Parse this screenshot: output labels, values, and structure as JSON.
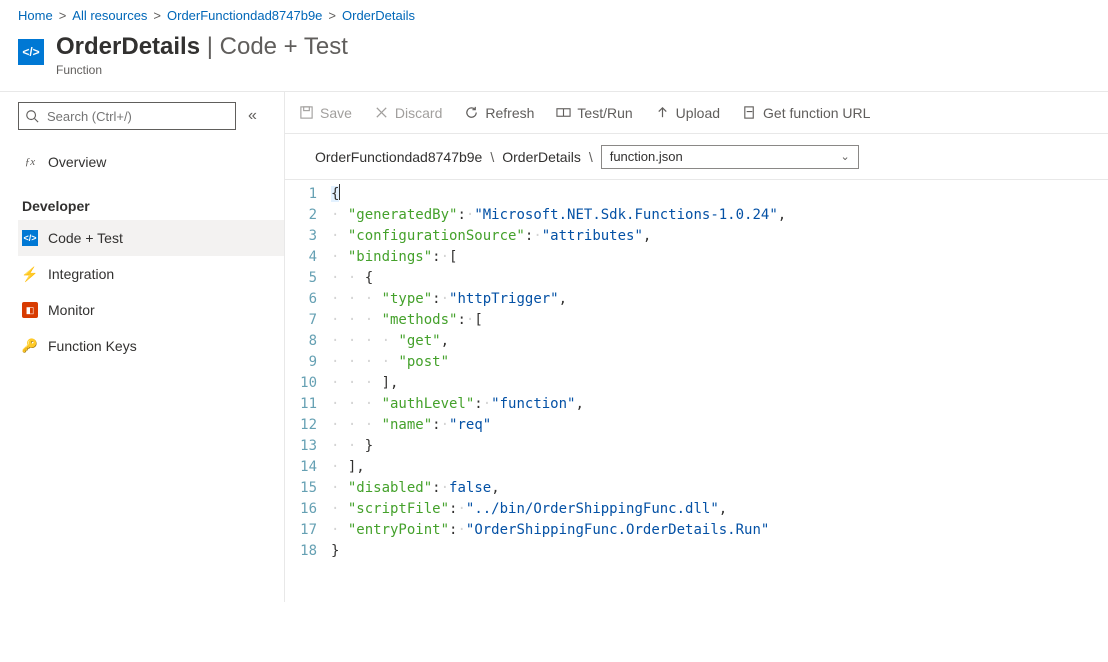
{
  "breadcrumb": [
    "Home",
    "All resources",
    "OrderFunctiondad8747b9e",
    "OrderDetails"
  ],
  "header": {
    "title_main": "OrderDetails",
    "title_sep": " | ",
    "title_sub": "Code + Test",
    "subtype": "Function",
    "glyph": "</>"
  },
  "sidebar": {
    "search_placeholder": "Search (Ctrl+/)",
    "overview": "Overview",
    "section_label": "Developer",
    "items": [
      {
        "label": "Code + Test",
        "icon": "ct",
        "selected": true
      },
      {
        "label": "Integration",
        "icon": "bolt",
        "selected": false
      },
      {
        "label": "Monitor",
        "icon": "monitor",
        "selected": false
      },
      {
        "label": "Function Keys",
        "icon": "key",
        "selected": false
      }
    ]
  },
  "toolbar": {
    "save": "Save",
    "discard": "Discard",
    "refresh": "Refresh",
    "testrun": "Test/Run",
    "upload": "Upload",
    "geturl": "Get function URL"
  },
  "pathbar": {
    "seg1": "OrderFunctiondad8747b9e",
    "seg2": "OrderDetails",
    "file": "function.json"
  },
  "code": {
    "line_count": 18,
    "json": {
      "generatedBy": "Microsoft.NET.Sdk.Functions-1.0.24",
      "configurationSource": "attributes",
      "bindings": [
        {
          "type": "httpTrigger",
          "methods": [
            "get",
            "post"
          ],
          "authLevel": "function",
          "name": "req"
        }
      ],
      "disabled": false,
      "scriptFile": "../bin/OrderShippingFunc.dll",
      "entryPoint": "OrderShippingFunc.OrderDetails.Run"
    }
  }
}
